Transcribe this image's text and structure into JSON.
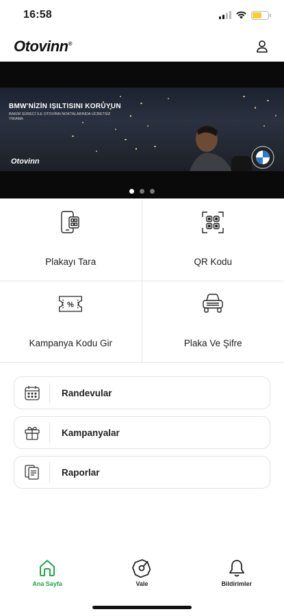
{
  "status_bar": {
    "time": "16:58"
  },
  "header": {
    "logo": "Otovinn",
    "logo_mark": "®"
  },
  "banner": {
    "heading": "BMW'NİZİN IŞILTISINI KORUYUN",
    "subtext": "BAKIM SÜRECİ İLE OTOVİNN NOKTALARINDA ÜCRETSİZ YIKAMA",
    "brand": "Otovinn",
    "slide_count": 3,
    "active_slide": 1
  },
  "actions": [
    {
      "label": "Plakayı Tara",
      "icon": "phone-scan-icon"
    },
    {
      "label": "QR Kodu",
      "icon": "qr-code-icon"
    },
    {
      "label": "Kampanya Kodu Gir",
      "icon": "coupon-percent-icon"
    },
    {
      "label": "Plaka Ve Şifre",
      "icon": "car-plate-icon"
    }
  ],
  "menu": [
    {
      "label": "Randevular",
      "icon": "calendar-icon"
    },
    {
      "label": "Kampanyalar",
      "icon": "gift-icon"
    },
    {
      "label": "Raporlar",
      "icon": "reports-icon"
    }
  ],
  "bottom_nav": [
    {
      "label": "Ana Sayfa",
      "icon": "home-icon",
      "active": true
    },
    {
      "label": "Vale",
      "icon": "vale-icon",
      "active": false
    },
    {
      "label": "Bildirimler",
      "icon": "bell-icon",
      "active": false
    }
  ],
  "colors": {
    "accent": "#1fa54a",
    "text": "#1e1e1e",
    "border": "#e3e3e3"
  }
}
